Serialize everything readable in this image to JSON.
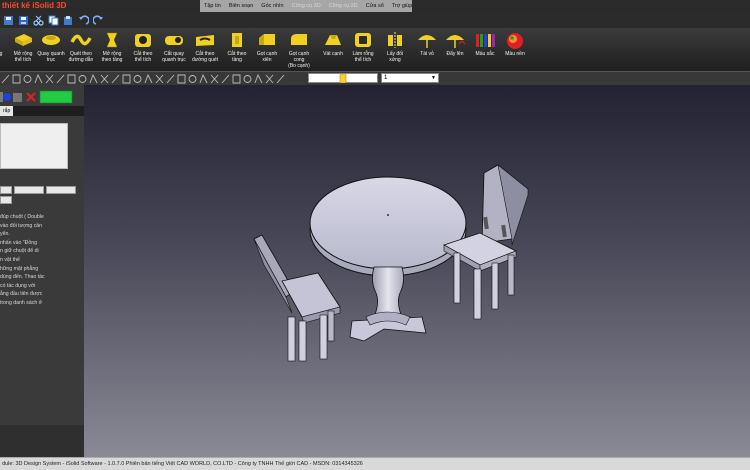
{
  "app": {
    "title": "thiết kế iSolid 3D"
  },
  "menubar": {
    "items": [
      {
        "label": "Tập tin",
        "enabled": true
      },
      {
        "label": "Biên soạn",
        "enabled": true
      },
      {
        "label": "Góc nhìn",
        "enabled": true
      },
      {
        "label": "Công cụ 3D",
        "enabled": false
      },
      {
        "label": "Công cụ 2D",
        "enabled": false
      },
      {
        "label": "Cửa sổ",
        "enabled": true
      },
      {
        "label": "Trợ giúp",
        "enabled": true
      }
    ]
  },
  "quick_access": {
    "icons": [
      "save-as-icon",
      "save-icon",
      "cut-icon",
      "copy-icon",
      "paste-icon",
      "undo-icon",
      "redo-icon"
    ]
  },
  "ribbon": {
    "tools": [
      {
        "label": "g",
        "icon": "partial-icon"
      },
      {
        "label": "Mở rộng\nthể tích",
        "icon": "extrude-icon"
      },
      {
        "label": "Quay quanh\ntrục",
        "icon": "revolve-icon"
      },
      {
        "label": "Quét theo\nđường dẫn",
        "icon": "sweep-icon"
      },
      {
        "label": "Mở rộng\ntheo tầng",
        "icon": "loft-icon"
      },
      {
        "label": "Cắt theo\nthể tích",
        "icon": "cut-extrude-icon"
      },
      {
        "label": "Cắt quay\nquanh trục",
        "icon": "cut-revolve-icon"
      },
      {
        "label": "Cắt theo\nđường quét",
        "icon": "cut-sweep-icon"
      },
      {
        "label": "Cắt theo\ntầng",
        "icon": "cut-loft-icon"
      },
      {
        "label": "Gọt cạnh\nxiên",
        "icon": "chamfer-icon"
      },
      {
        "label": "Gọt cạnh cong\n(Bo cạnh)",
        "icon": "fillet-icon"
      },
      {
        "label": "Vát cạnh",
        "icon": "bevel-icon"
      },
      {
        "label": "Làm rỗng\nthể tích",
        "icon": "shell-icon"
      },
      {
        "label": "Lấy đối\nxứng",
        "icon": "mirror-icon"
      },
      {
        "label": "Tái vỏ",
        "icon": "umbrella-icon"
      },
      {
        "label": "Đẩy lên",
        "icon": "push-up-icon"
      },
      {
        "label": "Màu sắc",
        "icon": "color-pencils-icon"
      },
      {
        "label": "Màu nền",
        "icon": "background-color-icon"
      }
    ]
  },
  "toolbar2": {
    "layer_value": "1",
    "color_accent": "#f5d23a"
  },
  "left_panel": {
    "tab_label": "rắp",
    "help_text": "đúp chuột ( Double\nvào đối tượng cần\nyển.\nnhấn vào \"Đồng\nn giữ chuột để di\nn vật thể\những mặt phẳng\ndùng đến. Thao tác\ncó tác dụng với\nằng đầu tiên được\ntrong danh sách ở"
  },
  "status": {
    "text": "dule: 3D Design System - iSolid Software - 1.0.7.0 Phiên bản tiếng Việt CAD WORLD, CO.LTD - Công ty TNHH Thế giới CAD - MSDN: 0314345326"
  },
  "colors": {
    "ribbon_icon": "#f0d020",
    "model_fill": "#c8c8d8",
    "red_accent": "#e02020",
    "green_swatch": "#22cc44"
  }
}
